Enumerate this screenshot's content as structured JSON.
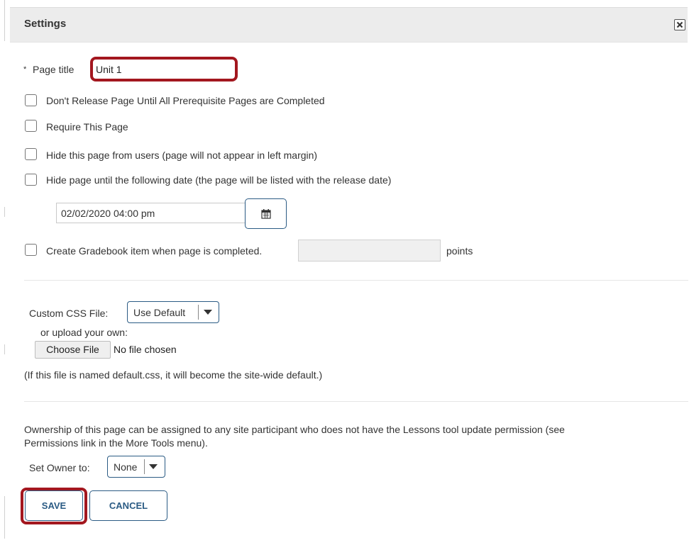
{
  "header": {
    "title": "Settings",
    "close_icon": "close-icon"
  },
  "page_title": {
    "required_mark": "*",
    "label": "Page title",
    "value": "Unit 1"
  },
  "options": {
    "release_label": "Don't Release Page Until All Prerequisite Pages are Completed",
    "require_label": "Require This Page",
    "hide_users_label": "Hide this page from users (page will not appear in left margin)",
    "hide_until_label": "Hide page until the following date (the page will be listed with the release date)",
    "release_date": "02/02/2020 04:00 pm",
    "calendar_icon": "calendar-icon",
    "gradebook_label": "Create Gradebook item when page is completed.",
    "points_value": "",
    "points_label": "points"
  },
  "css": {
    "label": "Custom CSS File:",
    "select_value": "Use Default",
    "upload_label": "or upload your own:",
    "choose_file_label": "Choose File",
    "no_file_label": "No file chosen",
    "note": "(If this file is named default.css, it will become the site-wide default.)"
  },
  "ownership": {
    "description_line1": "Ownership of this page can be assigned to any site participant who does not have the Lessons tool update permission (see",
    "description_line2": "Permissions link in the More Tools menu).",
    "owner_label": "Set Owner to:",
    "owner_value": "None"
  },
  "actions": {
    "save_label": "SAVE",
    "cancel_label": "CANCEL"
  },
  "colors": {
    "accent": "#2b5b84",
    "highlight": "#a3171f",
    "header_bg": "#ececec"
  }
}
